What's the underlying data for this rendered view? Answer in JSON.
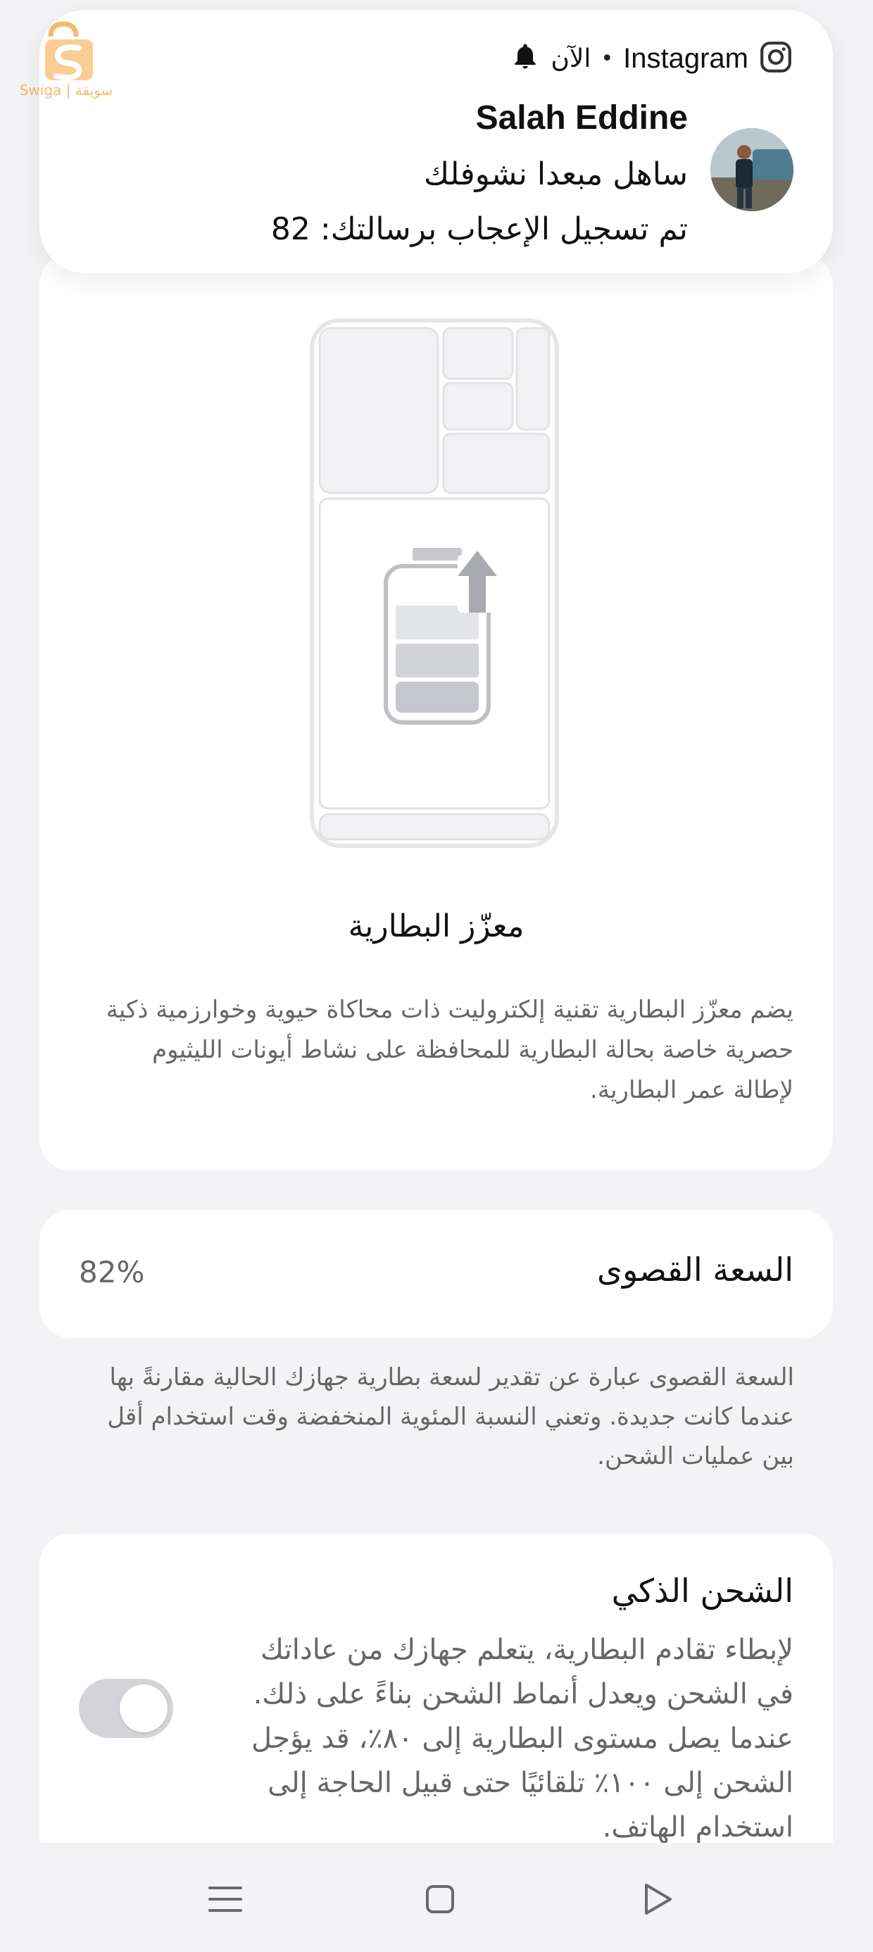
{
  "watermark": {
    "brand_text": "Swiga | سويقة"
  },
  "notification": {
    "app_name": "Instagram",
    "separator": "•",
    "time": "الآن",
    "sender": "Salah Eddine",
    "message": "ساهل مبعدا نشوفلك",
    "detail": "تم تسجيل الإعجاب برسالتك: 82",
    "icons": {
      "app": "instagram-icon",
      "alert": "bell-icon"
    }
  },
  "battery_protector": {
    "title": "معزّز البطارية",
    "description": "يضم معزّز البطارية تقنية إلكتروليت ذات محاكاة حيوية وخوارزمية ذكية حصرية خاصة بحالة البطارية للمحافظة على نشاط أيونات الليثيوم لإطالة عمر البطارية.",
    "illustration_icon": "battery-charging-icon"
  },
  "max_capacity": {
    "label": "السعة القصوى",
    "value": "82%",
    "note": "السعة القصوى عبارة عن تقدير لسعة بطارية جهازك الحالية مقارنةً بها عندما كانت جديدة. وتعني النسبة المئوية المنخفضة وقت استخدام أقل بين عمليات الشحن."
  },
  "smart_charging": {
    "title": "الشحن الذكي",
    "description": "لإبطاء تقادم البطارية، يتعلم جهازك من عاداتك في الشحن ويعدل أنماط الشحن بناءً على ذلك. عندما يصل مستوى البطارية إلى ٨٠٪، قد يؤجل الشحن إلى ١٠٠٪ تلقائيًا حتى قبيل الحاجة إلى استخدام الهاتف.",
    "enabled": false
  },
  "navbar": {
    "icons": [
      "menu-icon",
      "home-icon",
      "back-icon"
    ]
  }
}
